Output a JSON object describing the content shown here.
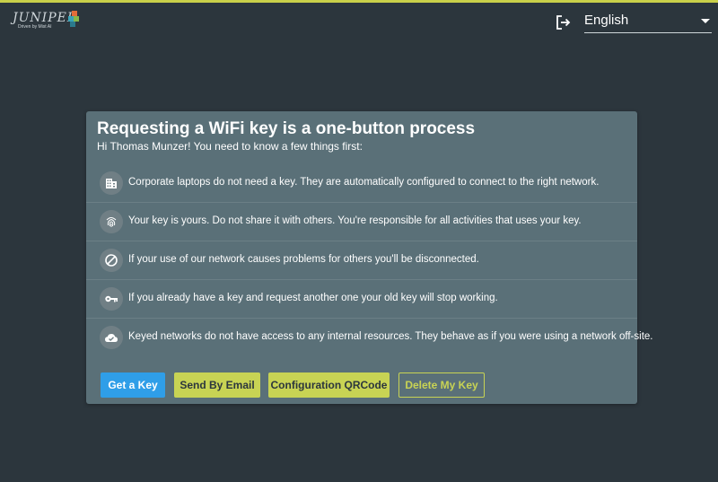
{
  "brand": {
    "logo_word": "JUNIPER",
    "logo_sub": "Driven by Mist AI",
    "colors": {
      "accent": "#c8d354",
      "primary": "#2f9ee8",
      "background": "#2c363d",
      "card": "#5a7078"
    }
  },
  "header": {
    "logout_icon": "logout-icon",
    "language": "English"
  },
  "card": {
    "title": "Requesting a WiFi key is a one-button process",
    "subtitle": "Hi Thomas Munzer! You need to know a few things first:",
    "items": [
      {
        "icon": "building-icon",
        "text": "Corporate laptops do not need a key. They are automatically configured to connect to the right network."
      },
      {
        "icon": "fingerprint-icon",
        "text": "Your key is yours. Do not share it with others. You're responsible for all activities that uses your key."
      },
      {
        "icon": "block-icon",
        "text": "If your use of our network causes problems for others you'll be disconnected."
      },
      {
        "icon": "key-icon",
        "text": "If you already have a key and request another one your old key will stop working."
      },
      {
        "icon": "cloud-done-icon",
        "text": "Keyed networks do not have access to any internal resources. They behave as if you were using a network off-site."
      }
    ],
    "buttons": {
      "get_key": "Get a Key",
      "send_email": "Send By Email",
      "qr_code": "Configuration QRCode",
      "delete_key": "Delete My Key"
    }
  }
}
